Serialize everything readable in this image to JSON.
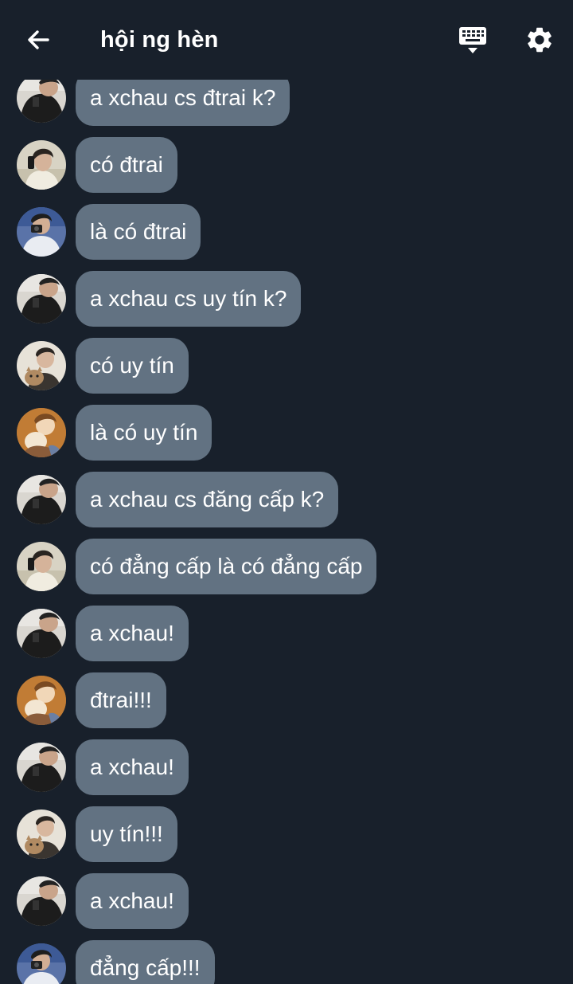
{
  "header": {
    "title": "hội ng hèn",
    "back_icon": "arrow-left-icon",
    "keyboard_icon": "keyboard-hide-icon",
    "settings_icon": "gear-icon"
  },
  "colors": {
    "background": "#18202b",
    "bubble": "#627282",
    "text": "#ffffff"
  },
  "messages": [
    {
      "avatar": "a",
      "text": "a xchau cs đtrai k?"
    },
    {
      "avatar": "b",
      "text": "có đtrai"
    },
    {
      "avatar": "c",
      "text": "là có đtrai"
    },
    {
      "avatar": "a",
      "text": "a xchau cs uy tín k?"
    },
    {
      "avatar": "d",
      "text": "có uy tín"
    },
    {
      "avatar": "e",
      "text": "là có uy tín"
    },
    {
      "avatar": "a",
      "text": "a xchau cs đăng cấp k?"
    },
    {
      "avatar": "b",
      "text": "có đẳng cấp là có đẳng cấp"
    },
    {
      "avatar": "a",
      "text": "a xchau!"
    },
    {
      "avatar": "e",
      "text": "đtrai!!!"
    },
    {
      "avatar": "a",
      "text": "a xchau!"
    },
    {
      "avatar": "d",
      "text": "uy tín!!!"
    },
    {
      "avatar": "a",
      "text": "a xchau!"
    },
    {
      "avatar": "c",
      "text": "đẳng cấp!!!"
    }
  ]
}
